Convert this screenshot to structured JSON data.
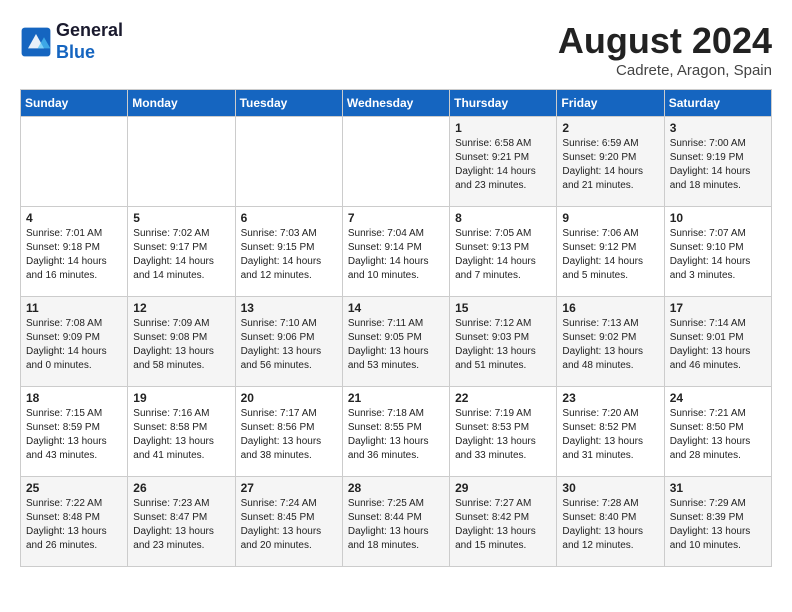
{
  "header": {
    "logo_line1": "General",
    "logo_line2": "Blue",
    "month_year": "August 2024",
    "location": "Cadrete, Aragon, Spain"
  },
  "days_of_week": [
    "Sunday",
    "Monday",
    "Tuesday",
    "Wednesday",
    "Thursday",
    "Friday",
    "Saturday"
  ],
  "weeks": [
    [
      {
        "day": "",
        "info": ""
      },
      {
        "day": "",
        "info": ""
      },
      {
        "day": "",
        "info": ""
      },
      {
        "day": "",
        "info": ""
      },
      {
        "day": "1",
        "info": "Sunrise: 6:58 AM\nSunset: 9:21 PM\nDaylight: 14 hours\nand 23 minutes."
      },
      {
        "day": "2",
        "info": "Sunrise: 6:59 AM\nSunset: 9:20 PM\nDaylight: 14 hours\nand 21 minutes."
      },
      {
        "day": "3",
        "info": "Sunrise: 7:00 AM\nSunset: 9:19 PM\nDaylight: 14 hours\nand 18 minutes."
      }
    ],
    [
      {
        "day": "4",
        "info": "Sunrise: 7:01 AM\nSunset: 9:18 PM\nDaylight: 14 hours\nand 16 minutes."
      },
      {
        "day": "5",
        "info": "Sunrise: 7:02 AM\nSunset: 9:17 PM\nDaylight: 14 hours\nand 14 minutes."
      },
      {
        "day": "6",
        "info": "Sunrise: 7:03 AM\nSunset: 9:15 PM\nDaylight: 14 hours\nand 12 minutes."
      },
      {
        "day": "7",
        "info": "Sunrise: 7:04 AM\nSunset: 9:14 PM\nDaylight: 14 hours\nand 10 minutes."
      },
      {
        "day": "8",
        "info": "Sunrise: 7:05 AM\nSunset: 9:13 PM\nDaylight: 14 hours\nand 7 minutes."
      },
      {
        "day": "9",
        "info": "Sunrise: 7:06 AM\nSunset: 9:12 PM\nDaylight: 14 hours\nand 5 minutes."
      },
      {
        "day": "10",
        "info": "Sunrise: 7:07 AM\nSunset: 9:10 PM\nDaylight: 14 hours\nand 3 minutes."
      }
    ],
    [
      {
        "day": "11",
        "info": "Sunrise: 7:08 AM\nSunset: 9:09 PM\nDaylight: 14 hours\nand 0 minutes."
      },
      {
        "day": "12",
        "info": "Sunrise: 7:09 AM\nSunset: 9:08 PM\nDaylight: 13 hours\nand 58 minutes."
      },
      {
        "day": "13",
        "info": "Sunrise: 7:10 AM\nSunset: 9:06 PM\nDaylight: 13 hours\nand 56 minutes."
      },
      {
        "day": "14",
        "info": "Sunrise: 7:11 AM\nSunset: 9:05 PM\nDaylight: 13 hours\nand 53 minutes."
      },
      {
        "day": "15",
        "info": "Sunrise: 7:12 AM\nSunset: 9:03 PM\nDaylight: 13 hours\nand 51 minutes."
      },
      {
        "day": "16",
        "info": "Sunrise: 7:13 AM\nSunset: 9:02 PM\nDaylight: 13 hours\nand 48 minutes."
      },
      {
        "day": "17",
        "info": "Sunrise: 7:14 AM\nSunset: 9:01 PM\nDaylight: 13 hours\nand 46 minutes."
      }
    ],
    [
      {
        "day": "18",
        "info": "Sunrise: 7:15 AM\nSunset: 8:59 PM\nDaylight: 13 hours\nand 43 minutes."
      },
      {
        "day": "19",
        "info": "Sunrise: 7:16 AM\nSunset: 8:58 PM\nDaylight: 13 hours\nand 41 minutes."
      },
      {
        "day": "20",
        "info": "Sunrise: 7:17 AM\nSunset: 8:56 PM\nDaylight: 13 hours\nand 38 minutes."
      },
      {
        "day": "21",
        "info": "Sunrise: 7:18 AM\nSunset: 8:55 PM\nDaylight: 13 hours\nand 36 minutes."
      },
      {
        "day": "22",
        "info": "Sunrise: 7:19 AM\nSunset: 8:53 PM\nDaylight: 13 hours\nand 33 minutes."
      },
      {
        "day": "23",
        "info": "Sunrise: 7:20 AM\nSunset: 8:52 PM\nDaylight: 13 hours\nand 31 minutes."
      },
      {
        "day": "24",
        "info": "Sunrise: 7:21 AM\nSunset: 8:50 PM\nDaylight: 13 hours\nand 28 minutes."
      }
    ],
    [
      {
        "day": "25",
        "info": "Sunrise: 7:22 AM\nSunset: 8:48 PM\nDaylight: 13 hours\nand 26 minutes."
      },
      {
        "day": "26",
        "info": "Sunrise: 7:23 AM\nSunset: 8:47 PM\nDaylight: 13 hours\nand 23 minutes."
      },
      {
        "day": "27",
        "info": "Sunrise: 7:24 AM\nSunset: 8:45 PM\nDaylight: 13 hours\nand 20 minutes."
      },
      {
        "day": "28",
        "info": "Sunrise: 7:25 AM\nSunset: 8:44 PM\nDaylight: 13 hours\nand 18 minutes."
      },
      {
        "day": "29",
        "info": "Sunrise: 7:27 AM\nSunset: 8:42 PM\nDaylight: 13 hours\nand 15 minutes."
      },
      {
        "day": "30",
        "info": "Sunrise: 7:28 AM\nSunset: 8:40 PM\nDaylight: 13 hours\nand 12 minutes."
      },
      {
        "day": "31",
        "info": "Sunrise: 7:29 AM\nSunset: 8:39 PM\nDaylight: 13 hours\nand 10 minutes."
      }
    ]
  ]
}
